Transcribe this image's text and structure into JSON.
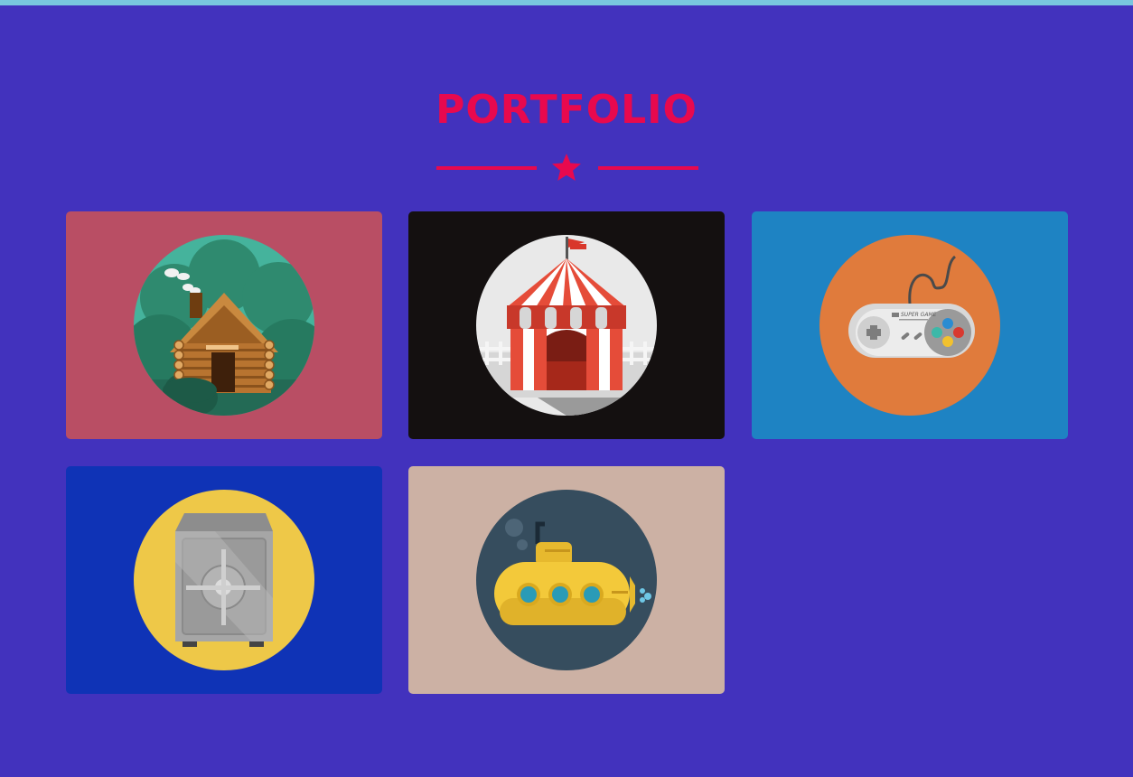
{
  "page": {
    "title": "PORTFOLIO",
    "colors": {
      "background": "#4232bd",
      "accent": "#e8094e",
      "topbar": "#79c6de"
    }
  },
  "portfolio": {
    "items": [
      {
        "icon": "log-cabin-icon",
        "bg": "#b94e64"
      },
      {
        "icon": "circus-tent-icon",
        "bg": "#141010"
      },
      {
        "icon": "game-controller-icon",
        "bg": "#1e83c3",
        "controller_label": "SUPER GAME"
      },
      {
        "icon": "safe-icon",
        "bg": "#0f33b6"
      },
      {
        "icon": "submarine-icon",
        "bg": "#ccb1a4"
      }
    ]
  }
}
